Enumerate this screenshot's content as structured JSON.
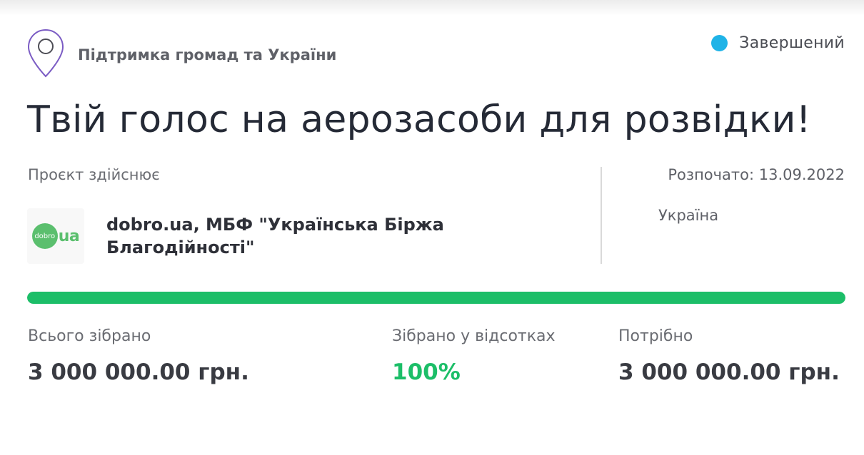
{
  "project": {
    "category": "Підтримка громад та України",
    "status": {
      "label": "Завершений",
      "color": "#1fb3e7"
    },
    "title": "Твій голос на аерозасоби для розвідки!",
    "implementer": {
      "heading": "Проєкт здійснює",
      "name": "dobro.ua, МБФ \"Українська Біржа Благодійності\"",
      "logo": {
        "circle_text": "dobro",
        "suffix": "ua",
        "color": "#5bbf6e"
      }
    },
    "started": "Розпочато: 13.09.2022",
    "location": "Україна",
    "progress": {
      "fraction": 1.0,
      "color": "#1cbe68"
    },
    "stats": {
      "collected": {
        "label": "Всього зібрано",
        "value": "3 000 000.00 грн."
      },
      "percent": {
        "label": "Зібрано у відсотках",
        "value": "100%"
      },
      "needed": {
        "label": "Потрібно",
        "value": "3 000 000.00 грн."
      }
    },
    "icons": {
      "category": "map-pin-icon"
    }
  }
}
